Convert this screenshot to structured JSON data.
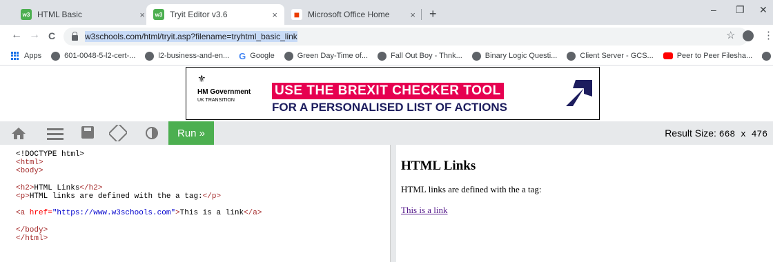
{
  "browser": {
    "tabs": [
      {
        "label": "HTML Basic",
        "icon": "w3schools-favicon",
        "close": "×"
      },
      {
        "label": "Tryit Editor v3.6",
        "icon": "w3schools-favicon",
        "close": "×",
        "active": true
      },
      {
        "label": "Microsoft Office Home",
        "icon": "office-favicon",
        "close": "×"
      }
    ],
    "new_tab": "+",
    "window_controls": {
      "minimize": "–",
      "restore": "❐",
      "close": "✕"
    },
    "nav": {
      "back": "←",
      "forward": "→",
      "reload": "C"
    },
    "url": "w3schools.com/html/tryit.asp?filename=tryhtml_basic_link",
    "bookmarks": [
      {
        "label": "Apps",
        "icon": "apps-grid-icon"
      },
      {
        "label": "601-0048-5-l2-cert-...",
        "icon": "globe-icon"
      },
      {
        "label": "l2-business-and-en...",
        "icon": "globe-icon"
      },
      {
        "label": "Google",
        "icon": "google-icon"
      },
      {
        "label": "Green Day-Time of...",
        "icon": "globe-icon"
      },
      {
        "label": "Fall Out Boy - Thnk...",
        "icon": "globe-icon"
      },
      {
        "label": "Binary Logic Questi...",
        "icon": "globe-icon"
      },
      {
        "label": "Client Server - GCS...",
        "icon": "globe-icon"
      },
      {
        "label": "Peer to Peer Filesha...",
        "icon": "youtube-icon"
      },
      {
        "label": "",
        "icon": "globe-icon"
      }
    ],
    "bookmarks_more": "»"
  },
  "ad": {
    "crest": "⚜",
    "org": "HM Government",
    "sub": "UK TRANSITION",
    "headline": "USE THE BREXIT CHECKER TOOL",
    "subline": "FOR A PERSONALISED LIST OF ACTIONS",
    "colors": {
      "headline_bg": "#e60050",
      "arrow": "#1d1d5e"
    }
  },
  "tryit": {
    "run_label": "Run »",
    "result_size_label": "Result Size:",
    "result_size_value": "668 x 476",
    "accent": "#4caf50"
  },
  "code": {
    "l1": "<!DOCTYPE html>",
    "l2": "<html>",
    "l3": "<body>",
    "l5": "<h2>",
    "l5b": "HTML Links",
    "l5c": "</h2>",
    "l6": "<p>",
    "l6b": "HTML links are defined with the a tag:",
    "l6c": "</p>",
    "l8a": "<a",
    "l8attr": " href=",
    "l8str": "\"https://www.w3schools.com\"",
    "l8close": ">",
    "l8text": "This is a link",
    "l8end": "</a>",
    "l10": "</body>",
    "l11": "</html>"
  },
  "result": {
    "heading": "HTML Links",
    "paragraph": "HTML links are defined with the a tag:",
    "link": "This is a link"
  }
}
